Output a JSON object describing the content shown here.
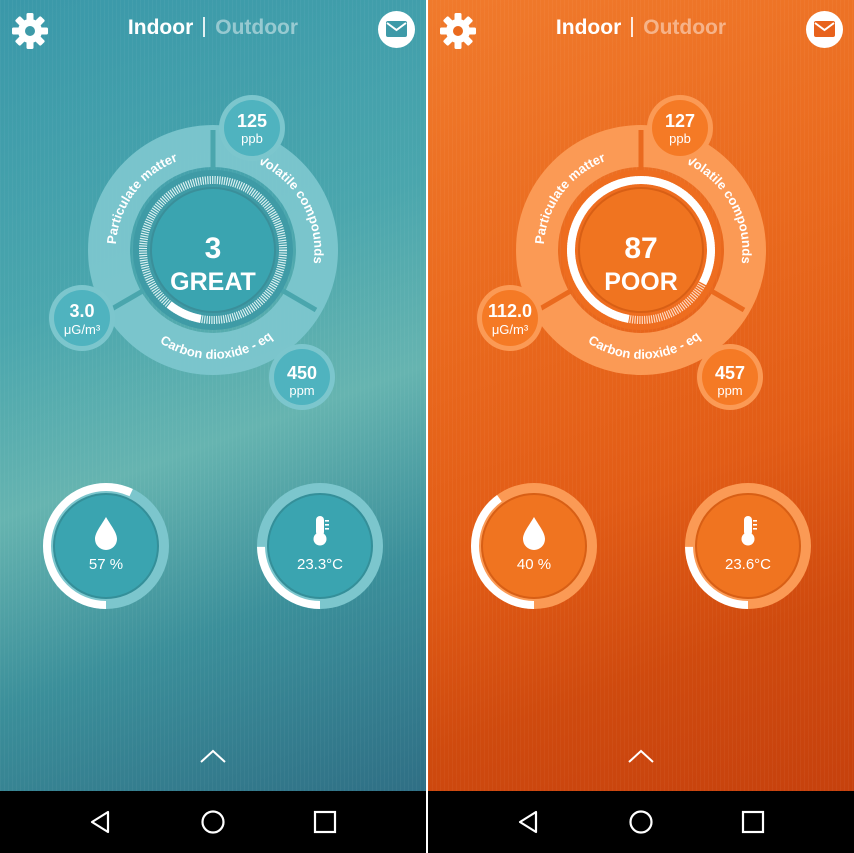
{
  "screens": [
    {
      "theme": {
        "accent": "#4fb3bf",
        "ring": "#7fcad1",
        "center": "#3aa4b0"
      },
      "header": {
        "tab_active": "Indoor",
        "tab_inactive": "Outdoor"
      },
      "score": {
        "value": "3",
        "label": "GREAT",
        "level": 0.12
      },
      "arcs": {
        "pm": "Particulate matter",
        "voc": "Volatile compounds",
        "co2": "Carbon dioxide - eq"
      },
      "voc": {
        "value": "125",
        "unit": "ppb"
      },
      "pm": {
        "value": "3.0",
        "unit": "μG/m³"
      },
      "co2": {
        "value": "450",
        "unit": "ppm"
      },
      "humidity": {
        "value": "57 %",
        "level": 0.57,
        "icon": "droplet-icon"
      },
      "temperature": {
        "value": "23.3°C",
        "level": 0.45,
        "icon": "thermometer-icon"
      }
    },
    {
      "theme": {
        "accent": "#f57a25",
        "ring": "#fb9a55",
        "center": "#f07420"
      },
      "header": {
        "tab_active": "Indoor",
        "tab_inactive": "Outdoor"
      },
      "score": {
        "value": "87",
        "label": "POOR",
        "level": 0.87
      },
      "arcs": {
        "pm": "Particulate matter",
        "voc": "Volatile compounds",
        "co2": "Carbon dioxide - eq"
      },
      "voc": {
        "value": "127",
        "unit": "ppb"
      },
      "pm": {
        "value": "112.0",
        "unit": "μG/m³"
      },
      "co2": {
        "value": "457",
        "unit": "ppm"
      },
      "humidity": {
        "value": "40 %",
        "level": 0.4,
        "icon": "droplet-icon"
      },
      "temperature": {
        "value": "23.6°C",
        "level": 0.45,
        "icon": "thermometer-icon"
      }
    }
  ],
  "icons": [
    "gear-icon",
    "mail-icon",
    "chevron-up-icon",
    "back-icon",
    "home-icon",
    "recents-icon"
  ]
}
